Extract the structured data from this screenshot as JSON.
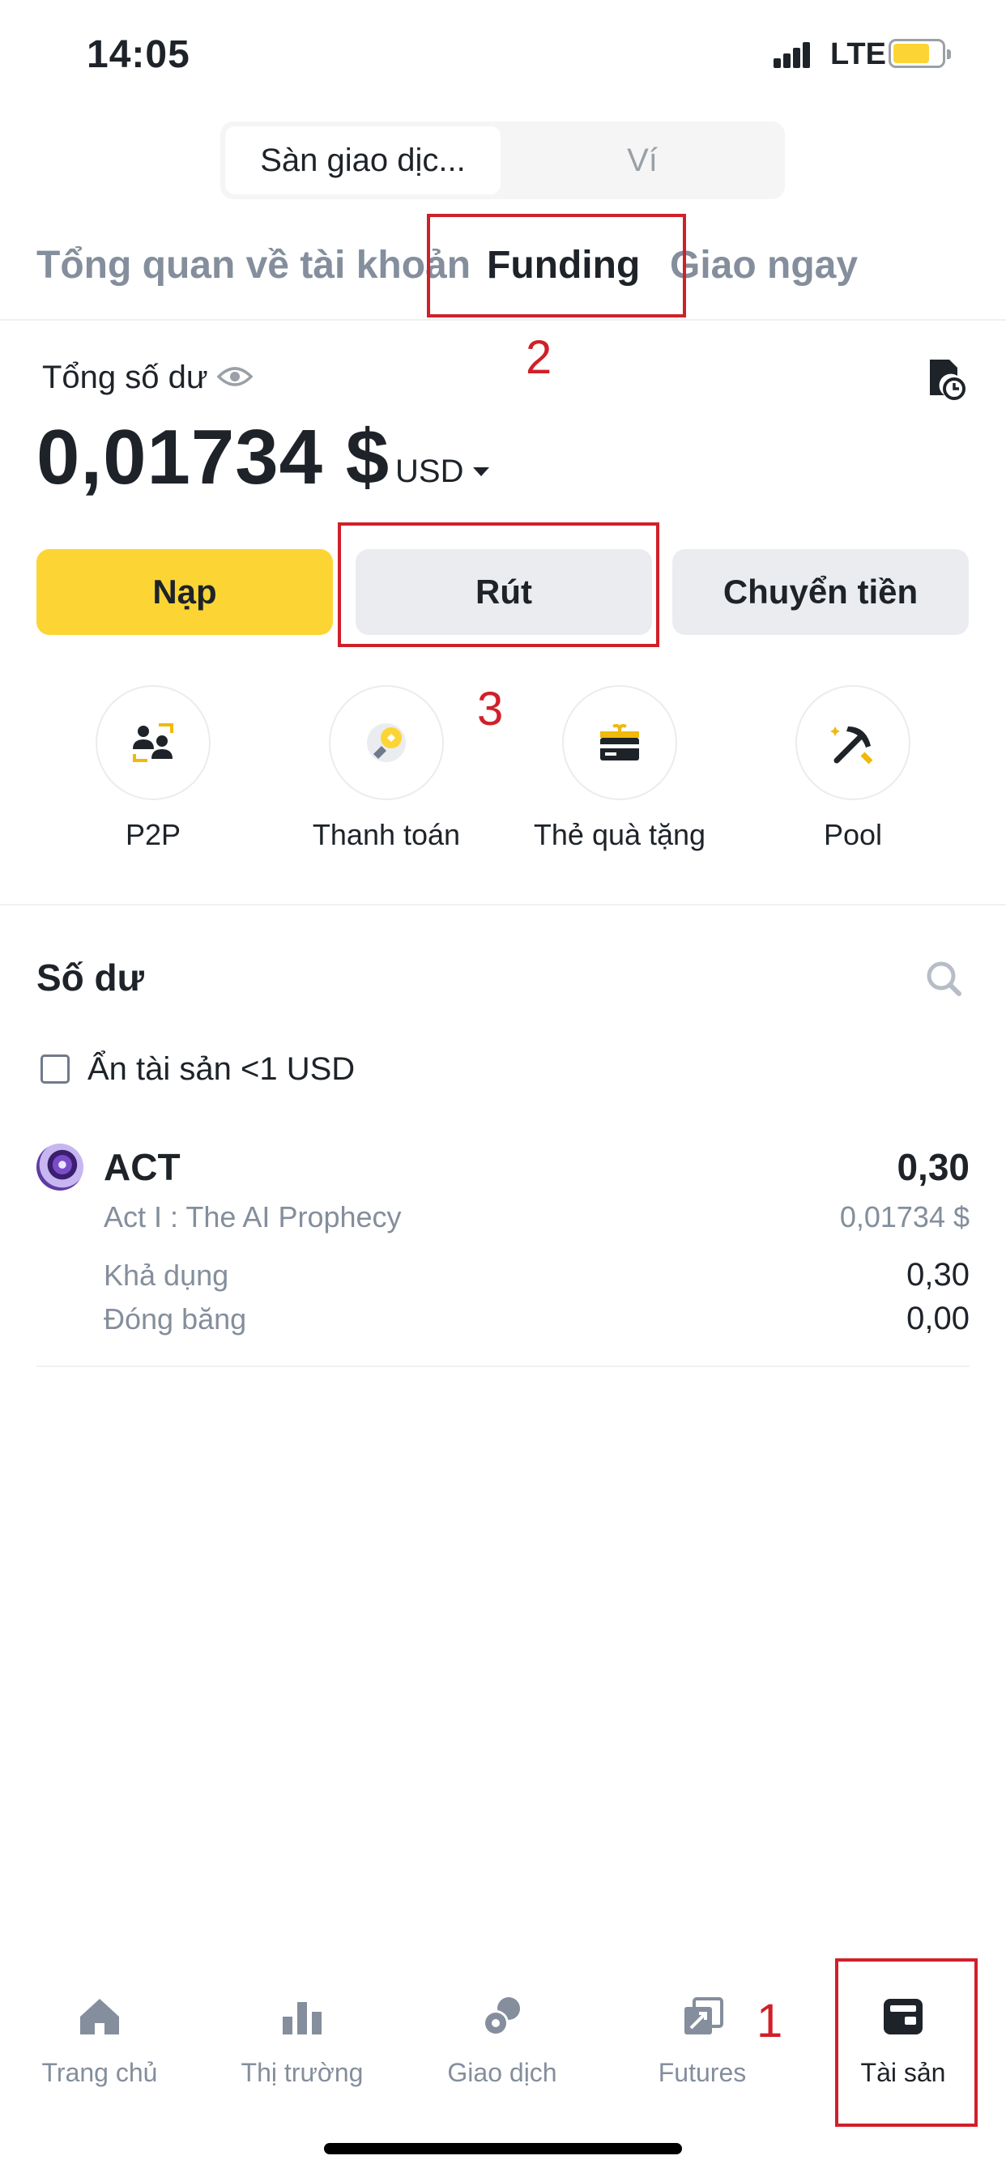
{
  "status_bar": {
    "time": "14:05",
    "network": "LTE",
    "battery_level": 0.7
  },
  "segment": {
    "active": "Sàn giao dịc...",
    "inactive": "Ví"
  },
  "tabs": [
    {
      "label": "Tổng quan về tài khoản"
    },
    {
      "label": "Funding"
    },
    {
      "label": "Giao ngay"
    }
  ],
  "balance": {
    "label": "Tổng số dư",
    "value": "0,01734 $",
    "currency": "USD"
  },
  "actions": {
    "deposit": "Nạp",
    "withdraw": "Rút",
    "transfer": "Chuyển tiền"
  },
  "quick_links": [
    {
      "label": "P2P",
      "icon": "p2p-icon"
    },
    {
      "label": "Thanh toán",
      "icon": "pay-icon"
    },
    {
      "label": "Thẻ quà tặng",
      "icon": "gift-card-icon"
    },
    {
      "label": "Pool",
      "icon": "pickaxe-icon"
    }
  ],
  "balances_section": {
    "title": "Số dư",
    "hide_small_label": "Ẩn tài sản <1 USD"
  },
  "assets": [
    {
      "symbol": "ACT",
      "name": "Act I : The AI Prophecy",
      "amount": "0,30",
      "usd_value": "0,01734 $",
      "available_label": "Khả dụng",
      "available_value": "0,30",
      "frozen_label": "Đóng băng",
      "frozen_value": "0,00"
    }
  ],
  "bottom_nav": [
    {
      "label": "Trang chủ",
      "icon": "home-icon"
    },
    {
      "label": "Thị trường",
      "icon": "markets-icon"
    },
    {
      "label": "Giao dịch",
      "icon": "trade-icon"
    },
    {
      "label": "Futures",
      "icon": "futures-icon"
    },
    {
      "label": "Tài sản",
      "icon": "wallet-icon",
      "active": true
    }
  ],
  "annotations": {
    "step1": "1",
    "step2": "2",
    "step3": "3"
  },
  "colors": {
    "accent": "#fcd535",
    "annotation": "#d0202a",
    "text": "#1e2329",
    "muted": "#848e9c"
  }
}
